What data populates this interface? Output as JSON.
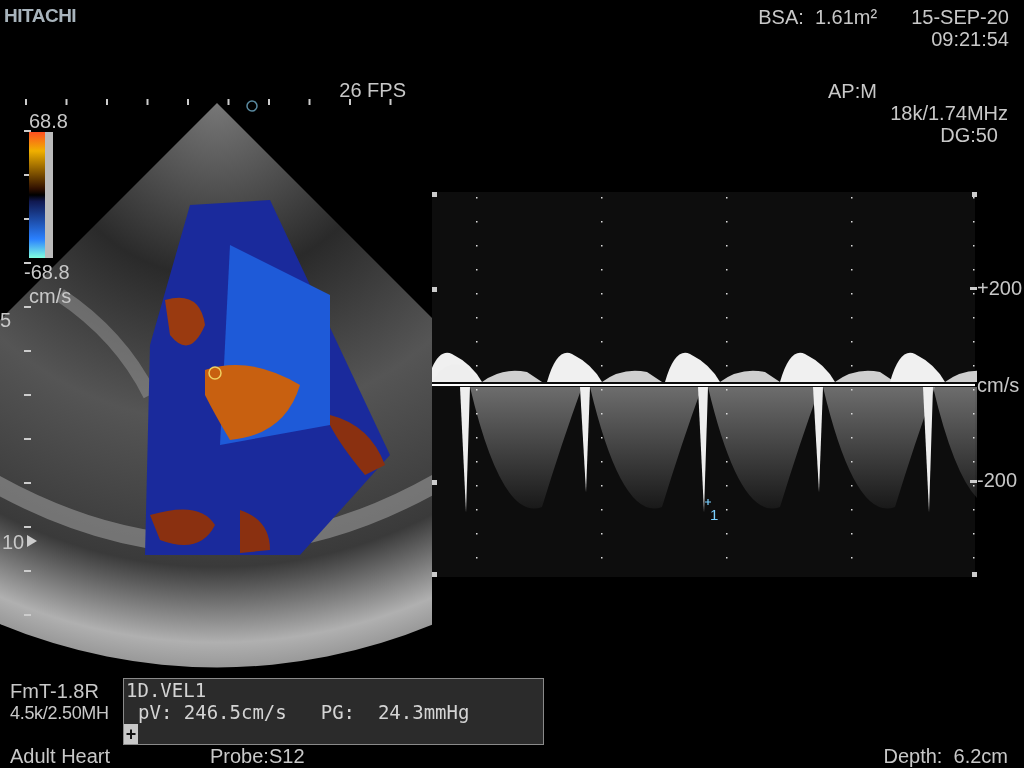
{
  "brand": "HITACHI",
  "header": {
    "bsa": "BSA:  1.61m²",
    "date": "15-SEP-20",
    "time": "09:21:54"
  },
  "bmode": {
    "frame_rate": "26 FPS",
    "color_scale": {
      "max": "68.8",
      "min": "-68.8",
      "unit": "cm/s"
    },
    "depth_marks": [
      "5",
      "10"
    ]
  },
  "doppler": {
    "mode": "AP:M",
    "prf": "18k/1.74MHz",
    "gain": "DG:50",
    "scale_labels": [
      "+200",
      "cm/s",
      "-200"
    ],
    "marker": "1"
  },
  "measurement": {
    "title": "1D.VEL1",
    "values": [
      "pV: 246.5cm/s",
      "PG:  24.3mmHg"
    ],
    "cursor": "+"
  },
  "footer": {
    "preset": "FmT-1.8R",
    "frequency": "4.5k/2.50MH",
    "application": "Adult Heart",
    "probe": "Probe:S12",
    "depth": "Depth:  6.2cm"
  }
}
